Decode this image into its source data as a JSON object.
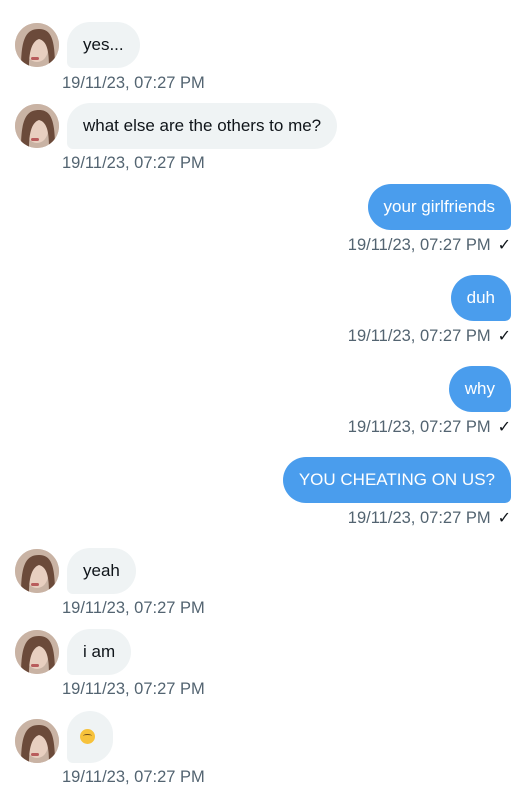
{
  "messages": [
    {
      "side": "in",
      "text": "yes...",
      "time": "19/11/23, 07:27 PM"
    },
    {
      "side": "in",
      "text": "what else are the others to me?",
      "time": "19/11/23, 07:27 PM"
    },
    {
      "side": "out",
      "text": "your girlfriends",
      "time": "19/11/23, 07:27 PM",
      "status": "✓"
    },
    {
      "side": "out",
      "text": "duh",
      "time": "19/11/23, 07:27 PM",
      "status": "✓"
    },
    {
      "side": "out",
      "text": "why",
      "time": "19/11/23, 07:27 PM",
      "status": "✓"
    },
    {
      "side": "out",
      "text": "YOU CHEATING ON US?",
      "time": "19/11/23, 07:27 PM",
      "status": "✓"
    },
    {
      "side": "in",
      "text": "yeah",
      "time": "19/11/23, 07:27 PM"
    },
    {
      "side": "in",
      "text": "i am",
      "time": "19/11/23, 07:27 PM"
    },
    {
      "side": "in",
      "emoji": "slightly-smiling-face-emoji",
      "time": "19/11/23, 07:27 PM"
    }
  ],
  "colors": {
    "incoming_bubble": "#eff3f4",
    "outgoing_bubble": "#4a9ded",
    "timestamp": "#536471"
  }
}
